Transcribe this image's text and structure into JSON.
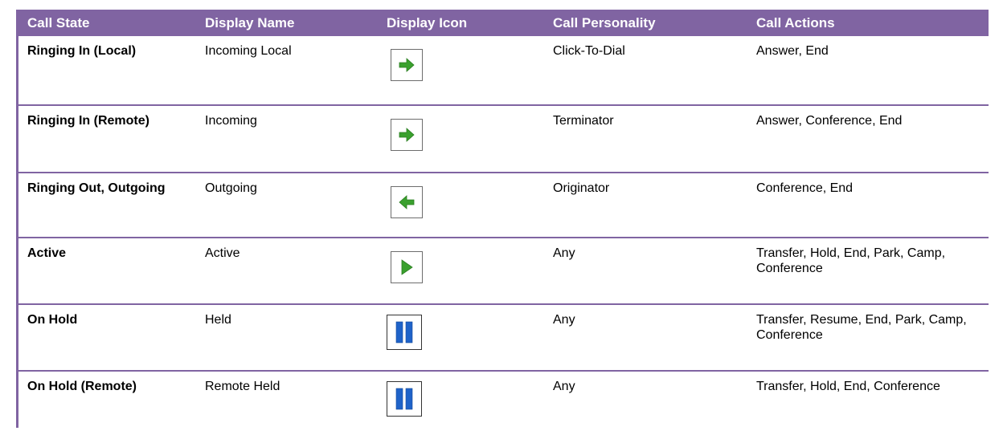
{
  "colors": {
    "header_bg": "#8064a2",
    "header_text": "#ffffff",
    "arrow_green": "#3aa02e",
    "pause_blue": "#1f63c9"
  },
  "table": {
    "headers": {
      "call_state": "Call State",
      "display_name": "Display Name",
      "display_icon": "Display Icon",
      "call_personality": "Call Personality",
      "call_actions": "Call Actions"
    },
    "rows": [
      {
        "call_state": "Ringing In (Local)",
        "display_name": "Incoming Local",
        "icon": "arrow-right-icon",
        "call_personality": "Click-To-Dial",
        "call_actions": "Answer, End"
      },
      {
        "call_state": "Ringing In (Remote)",
        "display_name": "Incoming",
        "icon": "arrow-right-icon",
        "call_personality": "Terminator",
        "call_actions": "Answer, Conference, End"
      },
      {
        "call_state": "Ringing Out, Outgoing",
        "display_name": "Outgoing",
        "icon": "arrow-left-icon",
        "call_personality": "Originator",
        "call_actions": "Conference, End"
      },
      {
        "call_state": "Active",
        "display_name": "Active",
        "icon": "play-icon",
        "call_personality": "Any",
        "call_actions": "Transfer, Hold, End, Park, Camp, Conference"
      },
      {
        "call_state": "On Hold",
        "display_name": "Held",
        "icon": "pause-icon",
        "call_personality": "Any",
        "call_actions": "Transfer, Resume, End, Park, Camp, Conference"
      },
      {
        "call_state": "On Hold (Remote)",
        "display_name": "Remote Held",
        "icon": "pause-icon",
        "call_personality": "Any",
        "call_actions": "Transfer, Hold, End, Conference"
      }
    ]
  }
}
